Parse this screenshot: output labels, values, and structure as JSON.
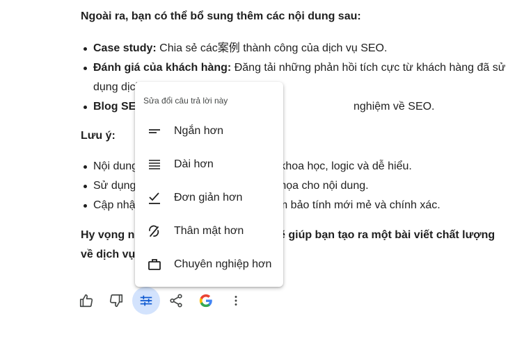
{
  "response": {
    "intro": "Ngoài ra, bạn có thể bổ sung thêm các nội dung sau:",
    "bullets": [
      {
        "bold": "Case study:",
        "text": " Chia sẻ các案例 thành công của dịch vụ SEO."
      },
      {
        "bold": "Đánh giá của khách hàng:",
        "text": " Đăng tải những phản hồi tích cực từ khách hàng đã sử dụng dịch"
      },
      {
        "bold": "Blog SE",
        "text": "nghiệm về SEO."
      }
    ],
    "note_heading": "Lưu ý:",
    "notes": [
      {
        "left": "Nội dung",
        "right": "n khoa học, logic và dễ hiểu."
      },
      {
        "left": "Sử dụng",
        "right": "n họa cho nội dung."
      },
      {
        "left": "Cập nhậ",
        "right": "ảm bảo tính mới mẻ và chính xác."
      }
    ],
    "closing_line1_left": "Hy vọng n",
    "closing_line1_right": "ẽ giúp bạn tạo ra một bài viết chất lượng",
    "closing_line2": "về dịch vụ"
  },
  "modify_menu": {
    "title": "Sửa đổi câu trả lời này",
    "items": [
      {
        "label": "Ngắn hơn",
        "icon": "short-text-icon"
      },
      {
        "label": "Dài hơn",
        "icon": "long-text-icon"
      },
      {
        "label": "Đơn giản hơn",
        "icon": "check-simplify-icon"
      },
      {
        "label": "Thân mật hơn",
        "icon": "casual-icon"
      },
      {
        "label": "Chuyên nghiệp hơn",
        "icon": "briefcase-icon"
      }
    ]
  },
  "toolbar": {
    "buttons": [
      "thumbs-up-icon",
      "thumbs-down-icon",
      "tune-icon",
      "share-icon",
      "google-icon",
      "more-vert-icon"
    ],
    "active": "tune-icon"
  },
  "colors": {
    "accent_bg": "#d3e3fd",
    "text": "#1f1f1f",
    "icon": "#444746"
  }
}
